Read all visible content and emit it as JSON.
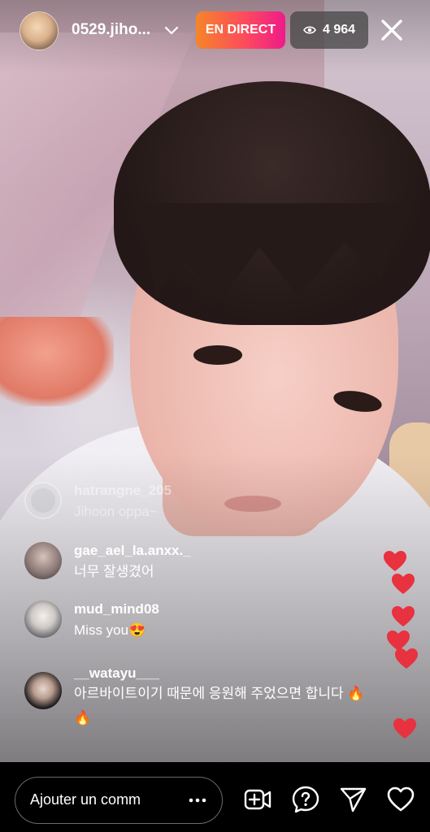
{
  "header": {
    "username": "0529.jiho...",
    "live_label": "EN DIRECT",
    "viewer_count": "4 964"
  },
  "comments": [
    {
      "user": "hatrangne_205",
      "text": "Jihoon oppa~",
      "faded": true
    },
    {
      "user": "gae_ael_la.anxx._",
      "text": "너무 잘생겼어"
    },
    {
      "user": "mud_mind08",
      "text": "Miss you😍"
    },
    {
      "user": "__watayu___",
      "text": "아르바이트이기 때문에 응원해 주었으면 합니다 🔥🔥"
    }
  ],
  "footer": {
    "comment_placeholder": "Ajouter un comm"
  },
  "colors": {
    "live_gradient_start": "#f58529",
    "live_gradient_end": "#ee1b8a",
    "heart": "#e8323f"
  },
  "icons": [
    "chevron-down-icon",
    "eye-icon",
    "close-icon",
    "more-dots-icon",
    "add-guest-icon",
    "question-icon",
    "send-icon",
    "heart-icon"
  ]
}
